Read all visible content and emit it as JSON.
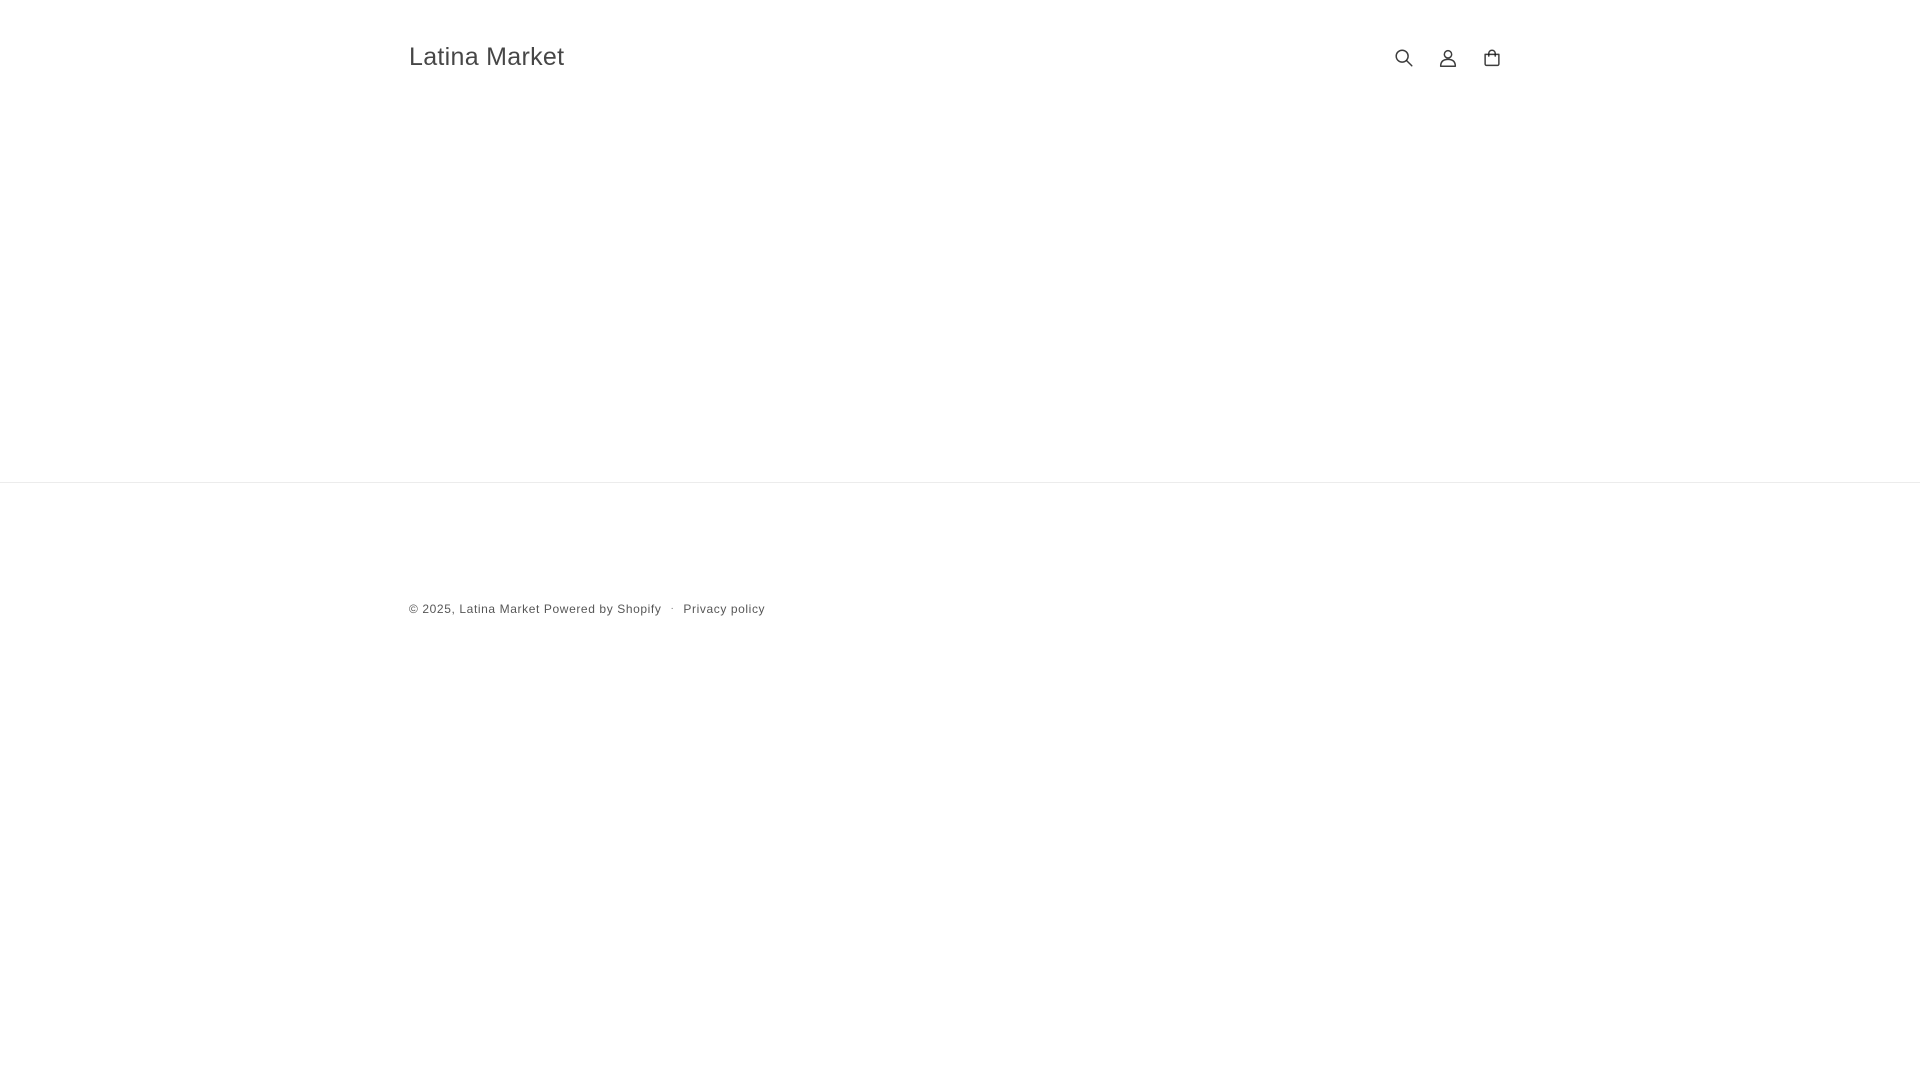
{
  "header": {
    "brand": "Latina Market",
    "icons": [
      "search-icon",
      "account-icon",
      "cart-icon"
    ]
  },
  "footer": {
    "copyright_prefix": "© 2025,",
    "brand_link": "Latina Market",
    "powered_by": "Powered by Shopify",
    "separator": "·",
    "privacy_policy": "Privacy policy"
  },
  "colors": {
    "background": "#ffffff",
    "text": "#121212",
    "divider": "#ececec"
  }
}
